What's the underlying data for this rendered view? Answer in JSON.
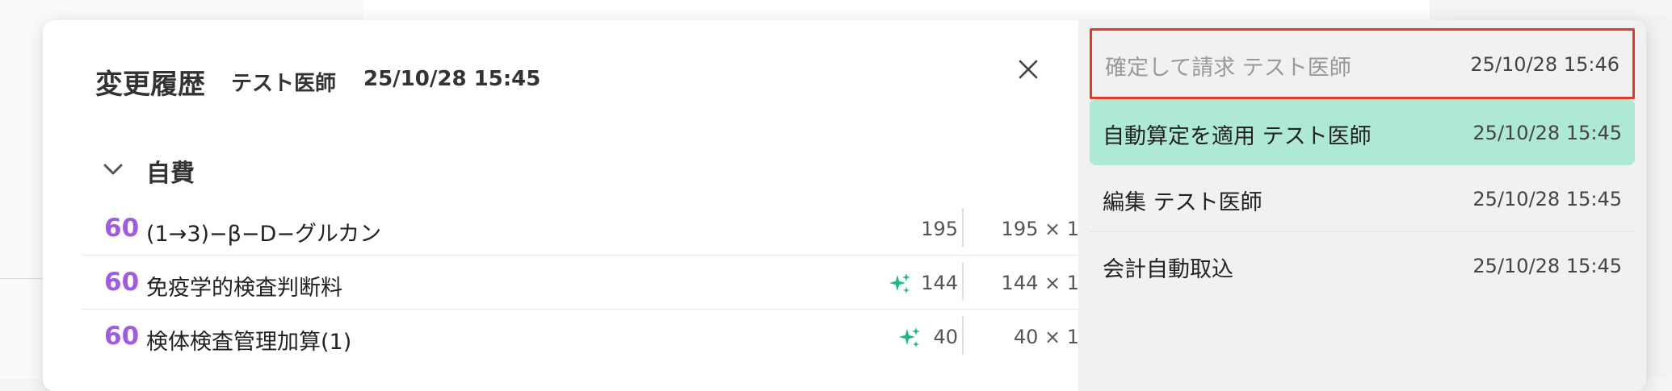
{
  "modal": {
    "title": "変更履歴",
    "author": "テスト医師",
    "timestamp": "25/10/28 15:45"
  },
  "section": {
    "label": "自費",
    "rows": [
      {
        "points": "60",
        "name": "(1→3)−β−D−グルカン",
        "amount": "195",
        "multiplier": "195 × 1",
        "auto": false
      },
      {
        "points": "60",
        "name": "免疫学的検査判断料",
        "amount": "144",
        "multiplier": "144 × 1",
        "auto": true
      },
      {
        "points": "60",
        "name": "検体検査管理加算(1)",
        "amount": "40",
        "multiplier": "40 × 1",
        "auto": true
      }
    ]
  },
  "history": [
    {
      "action": "確定して請求  テスト医師",
      "timestamp": "25/10/28 15:46",
      "state": "highlighted-outline"
    },
    {
      "action": "自動算定を適用  テスト医師",
      "timestamp": "25/10/28 15:45",
      "state": "selected"
    },
    {
      "action": "編集  テスト医師",
      "timestamp": "25/10/28 15:45",
      "state": "normal"
    },
    {
      "action": "会計自動取込",
      "timestamp": "25/10/28 15:45",
      "state": "normal"
    }
  ],
  "colors": {
    "points": "#a05ce0",
    "sparkle": "#1fb889",
    "selected_bg": "#aee9d3",
    "outline": "#e03a2a"
  },
  "icons": {
    "close": "close-icon",
    "collapse": "chevron-down-icon",
    "auto": "sparkle-icon"
  }
}
